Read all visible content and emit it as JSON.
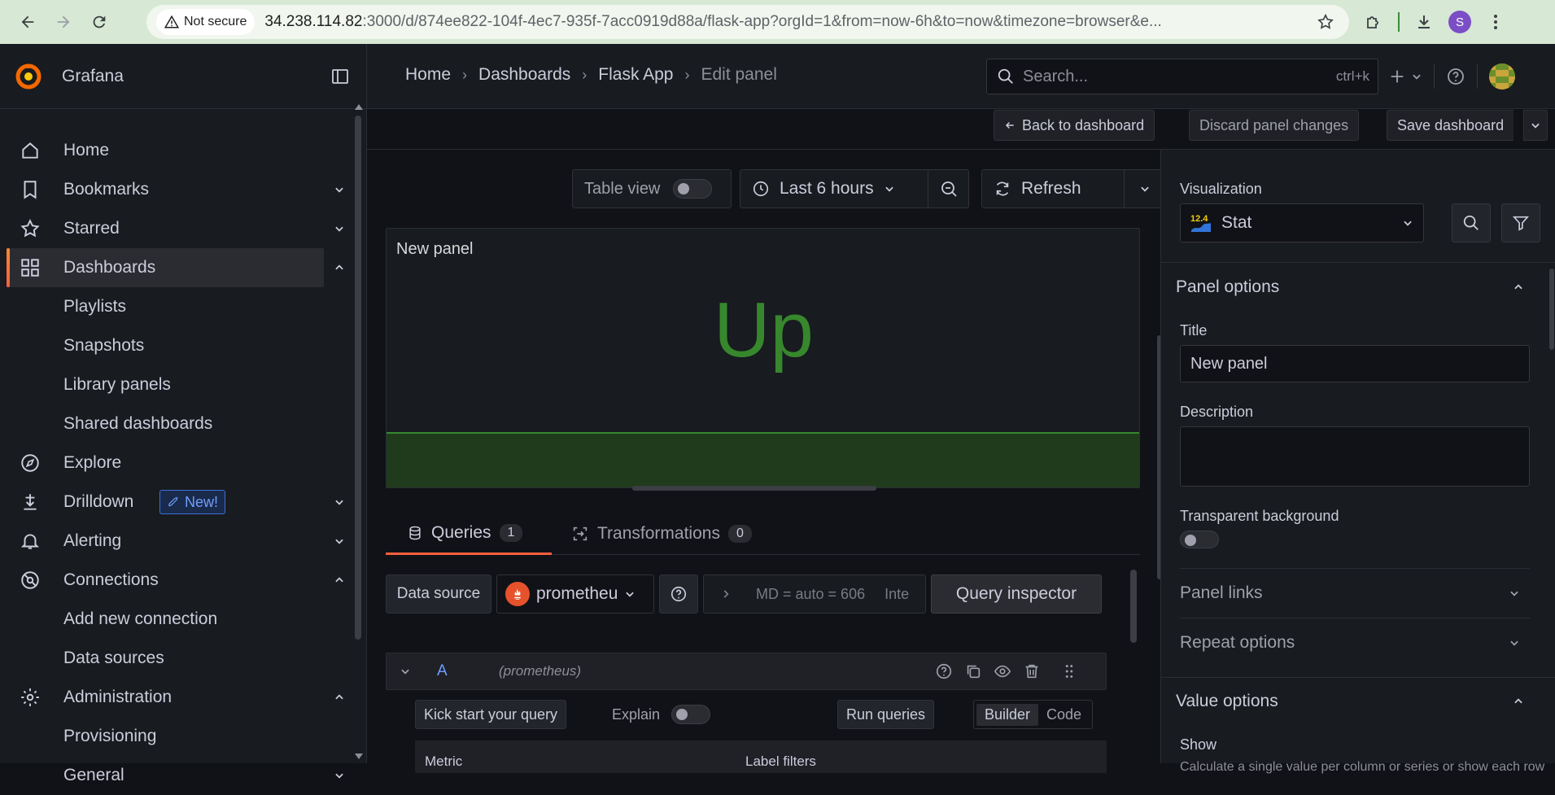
{
  "browser": {
    "security_label": "Not secure",
    "url_host": "34.238.114.82",
    "url_rest": ":3000/d/874ee822-104f-4ec7-935f-7acc0919d88a/flask-app?orgId=1&from=now-6h&to=now&timezone=browser&e...",
    "profile_initial": "S"
  },
  "app": {
    "name": "Grafana",
    "accent_color": "#f55f3e",
    "stat_color": "#37872d"
  },
  "breadcrumb": {
    "items": [
      "Home",
      "Dashboards",
      "Flask App"
    ],
    "current": "Edit panel"
  },
  "search": {
    "placeholder": "Search...",
    "shortcut": "ctrl+k"
  },
  "actions": {
    "back": "Back to dashboard",
    "discard": "Discard panel changes",
    "save": "Save dashboard"
  },
  "sidebar": {
    "items": [
      {
        "label": "Home",
        "icon": "home-icon"
      },
      {
        "label": "Bookmarks",
        "icon": "bookmark-icon"
      },
      {
        "label": "Starred",
        "icon": "star-icon"
      },
      {
        "label": "Dashboards",
        "icon": "apps-icon"
      },
      {
        "label": "Playlists"
      },
      {
        "label": "Snapshots"
      },
      {
        "label": "Library panels"
      },
      {
        "label": "Shared dashboards"
      },
      {
        "label": "Explore",
        "icon": "compass-icon"
      },
      {
        "label": "Drilldown",
        "icon": "drilldown-icon",
        "badge": "New!"
      },
      {
        "label": "Alerting",
        "icon": "bell-icon"
      },
      {
        "label": "Connections",
        "icon": "connections-icon"
      },
      {
        "label": "Add new connection"
      },
      {
        "label": "Data sources"
      },
      {
        "label": "Administration",
        "icon": "gear-icon"
      },
      {
        "label": "Provisioning"
      },
      {
        "label": "General"
      }
    ]
  },
  "toolbar": {
    "table_view": "Table view",
    "time_range": "Last 6 hours",
    "refresh": "Refresh"
  },
  "panel": {
    "title": "New panel",
    "value": "Up"
  },
  "tabs": {
    "queries": "Queries",
    "queries_count": "1",
    "transformations": "Transformations",
    "transformations_count": "0"
  },
  "query": {
    "ds_label": "Data source",
    "ds_value": "prometheu",
    "options_summary": "MD = auto = 606",
    "options_more": "Inte",
    "inspector": "Query inspector",
    "letter": "A",
    "ds_name": "(prometheus)",
    "kick_start": "Kick start your query",
    "explain": "Explain",
    "run": "Run queries",
    "mode_builder": "Builder",
    "mode_code": "Code",
    "metric_label": "Metric",
    "label_filters": "Label filters"
  },
  "options": {
    "visualization_label": "Visualization",
    "visualization": "Stat",
    "viz_version": "12.4",
    "panel_options": "Panel options",
    "title_label": "Title",
    "title_value": "New panel",
    "description_label": "Description",
    "transparent_label": "Transparent background",
    "panel_links": "Panel links",
    "repeat_options": "Repeat options",
    "value_options": "Value options",
    "show_label": "Show",
    "show_desc": "Calculate a single value per column or series or show each row"
  }
}
